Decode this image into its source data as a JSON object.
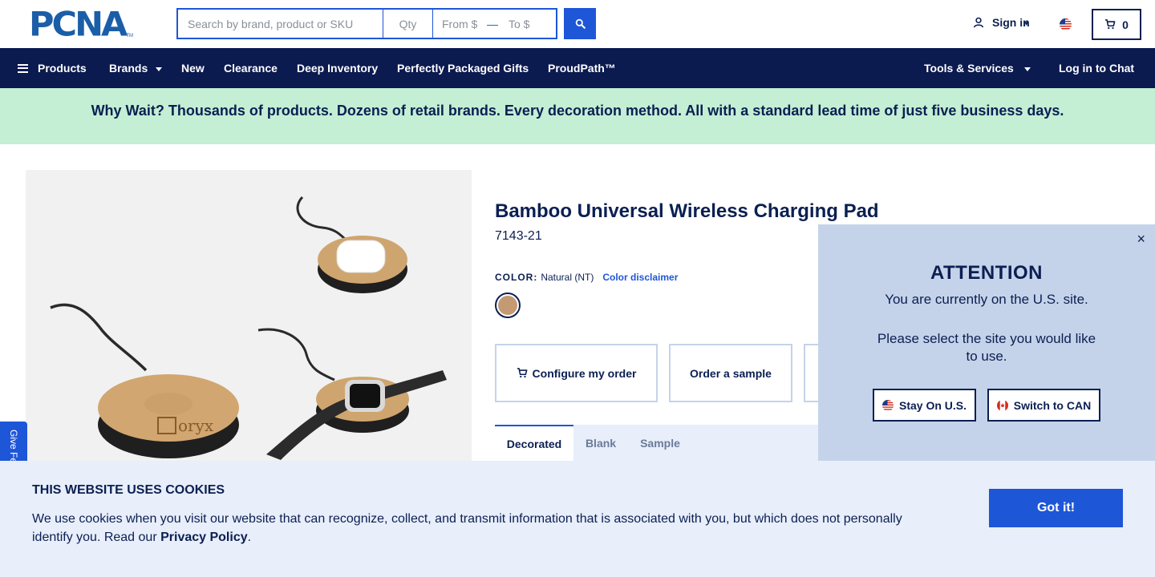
{
  "header": {
    "logo_text": "PCNA",
    "logo_tm": "TM",
    "search": {
      "placeholder": "Search by brand, product or SKU",
      "qty_placeholder": "Qty",
      "from_placeholder": "From $",
      "to_placeholder": "To $",
      "separator": "—"
    },
    "signin_label": "Sign in",
    "cart_count": "0"
  },
  "nav": {
    "items": [
      {
        "label": "Products"
      },
      {
        "label": "Brands"
      },
      {
        "label": "New"
      },
      {
        "label": "Clearance"
      },
      {
        "label": "Deep Inventory"
      },
      {
        "label": "Perfectly Packaged Gifts"
      },
      {
        "label": "ProudPath™"
      }
    ],
    "tools_label": "Tools & Services",
    "chat_label": "Log in to Chat"
  },
  "banner": {
    "text": "Why Wait? Thousands of products. Dozens of retail brands. Every decoration method. All with a standard lead time of just five business days."
  },
  "product": {
    "title": "Bamboo Universal Wireless Charging Pad",
    "sku": "7143-21",
    "color_label": "COLOR:",
    "color_value": "Natural (NT)",
    "color_disclaimer": "Color disclaimer",
    "swatch_color": "#c49a73",
    "image_logo_text": "oryx",
    "actions": {
      "configure": "Configure my order",
      "sample": "Order a sample"
    },
    "tabs": [
      "Decorated",
      "Blank",
      "Sample"
    ]
  },
  "feedback": {
    "label": "Give Fe"
  },
  "attention": {
    "close": "×",
    "title": "ATTENTION",
    "line1": "You are currently on the U.S. site.",
    "line2": "Please select the site you would like to use.",
    "stay_label": "Stay On U.S.",
    "switch_label": "Switch to CAN"
  },
  "cookie": {
    "title": "THIS WEBSITE USES COOKIES",
    "text_before": "We use cookies when you visit our website that can recognize, collect, and transmit information that is associated with you, but which does not personally identify you. Read our ",
    "link": "Privacy Policy",
    "text_after": ".",
    "button": "Got it!"
  },
  "colors": {
    "navy": "#0b1a4f",
    "accent_blue": "#1e56d8",
    "banner_green": "#c4efd4",
    "panel_blue": "#c5d3ea",
    "light_panel": "#e8eefa"
  }
}
